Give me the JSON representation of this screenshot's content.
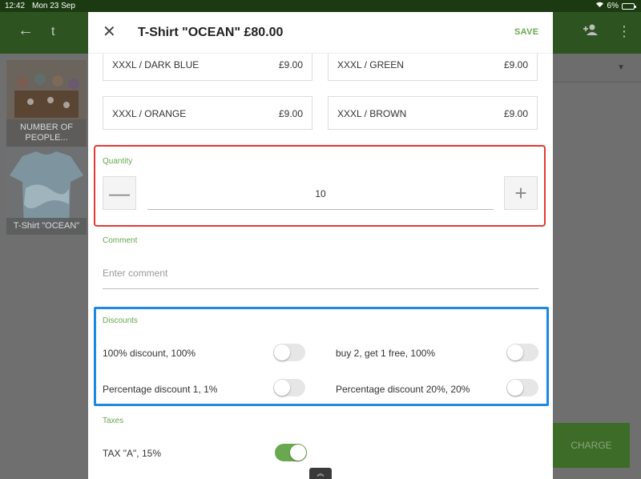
{
  "status_bar": {
    "time": "12:42",
    "date": "Mon 23 Sep",
    "battery": "6%"
  },
  "background_app": {
    "title": "t",
    "tiles": [
      {
        "label": "NUMBER OF PEOPLE..."
      },
      {
        "label": "T-Shirt \"OCEAN\""
      }
    ],
    "charge_label": "CHARGE"
  },
  "modal": {
    "title": "T-Shirt \"OCEAN\" £80.00",
    "save_label": "SAVE",
    "variants": [
      {
        "name": "XXXL / DARK BLUE",
        "price": "£9.00"
      },
      {
        "name": "XXXL / GREEN",
        "price": "£9.00"
      },
      {
        "name": "XXXL / ORANGE",
        "price": "£9.00"
      },
      {
        "name": "XXXL / BROWN",
        "price": "£9.00"
      }
    ],
    "quantity": {
      "label": "Quantity",
      "value": "10",
      "minus": "—",
      "plus": "+"
    },
    "comment": {
      "label": "Comment",
      "placeholder": "Enter comment"
    },
    "discounts": {
      "label": "Discounts",
      "items": [
        {
          "label": "100% discount, 100%",
          "on": false
        },
        {
          "label": "buy 2, get 1 free, 100%",
          "on": false
        },
        {
          "label": "Percentage discount 1, 1%",
          "on": false
        },
        {
          "label": "Percentage discount 20%, 20%",
          "on": false
        }
      ]
    },
    "taxes": {
      "label": "Taxes",
      "items": [
        {
          "label": "TAX \"A\", 15%",
          "on": true
        }
      ]
    }
  }
}
